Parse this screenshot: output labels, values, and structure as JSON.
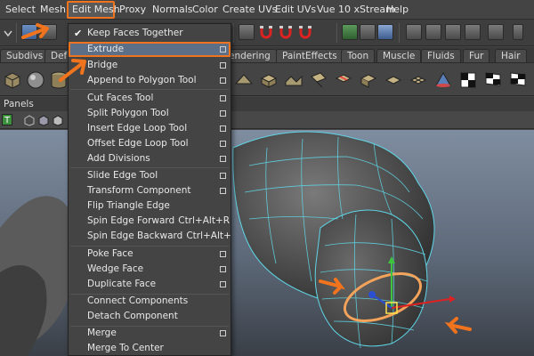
{
  "menubar": {
    "items": [
      "Select",
      "Mesh",
      "Edit Mesh",
      "Proxy",
      "Normals",
      "Color",
      "Create UVs",
      "Edit UVs",
      "Vue 10 xStream",
      "Help"
    ],
    "active": "Edit Mesh"
  },
  "shelf_tabs": [
    "Subdivs",
    "Defo",
    "endering",
    "PaintEffects",
    "Toon",
    "Muscle",
    "Fluids",
    "Fur",
    "Hair"
  ],
  "panels_label": "Panels",
  "viewbar": {
    "t_icon": "T"
  },
  "dropdown": {
    "items": [
      {
        "label": "Keep Faces Together",
        "checked": true,
        "option": false
      },
      {
        "label": "Extrude",
        "checked": false,
        "option": true,
        "selected": true
      },
      {
        "label": "Bridge",
        "checked": false,
        "option": true
      },
      {
        "label": "Append to Polygon Tool",
        "checked": false,
        "option": true
      },
      {
        "label": "Cut Faces Tool",
        "checked": false,
        "option": true
      },
      {
        "label": "Split Polygon Tool",
        "checked": false,
        "option": true
      },
      {
        "label": "Insert Edge Loop Tool",
        "checked": false,
        "option": true
      },
      {
        "label": "Offset Edge Loop Tool",
        "checked": false,
        "option": true
      },
      {
        "label": "Add Divisions",
        "checked": false,
        "option": true
      },
      {
        "label": "Slide Edge Tool",
        "checked": false,
        "option": true
      },
      {
        "label": "Transform Component",
        "checked": false,
        "option": true
      },
      {
        "label": "Flip Triangle Edge",
        "checked": false,
        "option": false
      },
      {
        "label": "Spin Edge Forward",
        "shortcut": "Ctrl+Alt+Right",
        "checked": false,
        "option": false
      },
      {
        "label": "Spin Edge Backward",
        "shortcut": "Ctrl+Alt+Left",
        "checked": false,
        "option": false
      },
      {
        "label": "Poke Face",
        "checked": false,
        "option": true
      },
      {
        "label": "Wedge Face",
        "checked": false,
        "option": true
      },
      {
        "label": "Duplicate Face",
        "checked": false,
        "option": true
      },
      {
        "label": "Connect Components",
        "checked": false,
        "option": false
      },
      {
        "label": "Detach Component",
        "checked": false,
        "option": false
      },
      {
        "label": "Merge",
        "checked": false,
        "option": true
      },
      {
        "label": "Merge To Center",
        "checked": false,
        "option": false
      }
    ]
  },
  "colors": {
    "highlight": "#f0731e",
    "menu_bg": "#444444",
    "wireframe": "#5fd6e6",
    "selection": "#f3a35a"
  },
  "icons": [
    "arrow-select-icon",
    "lasso-icon",
    "magnet-icon",
    "render-icon",
    "cube-icon",
    "sphere-icon",
    "grid-icon",
    "checker-icon",
    "manipulator-icon"
  ]
}
